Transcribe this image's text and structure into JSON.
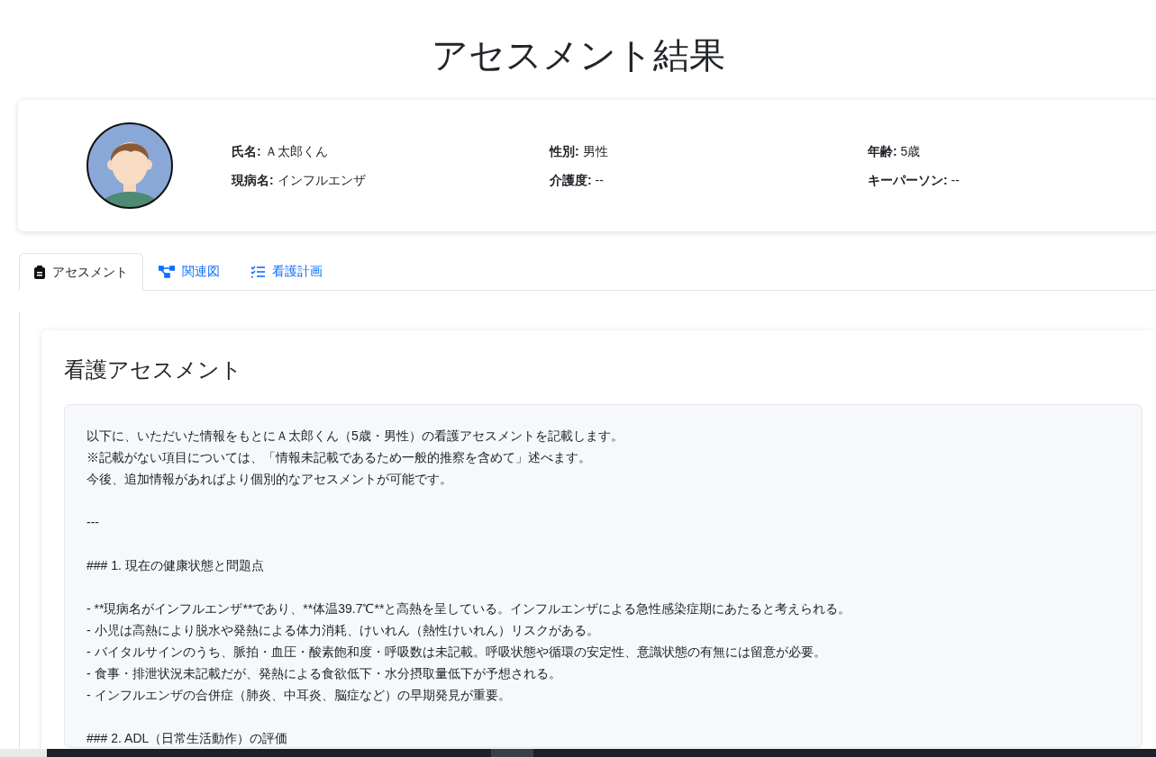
{
  "page_title": "アセスメント結果",
  "patient": {
    "fields": [
      {
        "label": "氏名:",
        "value": "Ａ太郎くん"
      },
      {
        "label": "性別:",
        "value": "男性"
      },
      {
        "label": "年齢:",
        "value": "5歳"
      },
      {
        "label": "現病名:",
        "value": "インフルエンザ"
      },
      {
        "label": "介護度:",
        "value": "--"
      },
      {
        "label": "キーパーソン:",
        "value": "--"
      }
    ]
  },
  "tabs": [
    {
      "label": "アセスメント",
      "kind": "clipboard",
      "selected": true
    },
    {
      "label": "関連図",
      "kind": "diagram",
      "selected": false
    },
    {
      "label": "看護計画",
      "kind": "checklist",
      "selected": false
    }
  ],
  "assessment": {
    "title": "看護アセスメント",
    "blocks": [
      [
        "以下に、いただいた情報をもとにＡ太郎くん（5歳・男性）の看護アセスメントを記載します。",
        "※記載がない項目については、「情報未記載であるため一般的推察を含めて」述べます。",
        "今後、追加情報があればより個別的なアセスメントが可能です。"
      ],
      [
        "---"
      ],
      [
        "### 1. 現在の健康状態と問題点"
      ],
      [
        "- **現病名がインフルエンザ**であり、**体温39.7℃**と高熱を呈している。インフルエンザによる急性感染症期にあたると考えられる。",
        "- 小児は高熱により脱水や発熱による体力消耗、けいれん（熱性けいれん）リスクがある。",
        "- バイタルサインのうち、脈拍・血圧・酸素飽和度・呼吸数は未記載。呼吸状態や循環の安定性、意識状態の有無には留意が必要。",
        "- 食事・排泄状況未記載だが、発熱による食欲低下・水分摂取量低下が予想される。",
        "- インフルエンザの合併症（肺炎、中耳炎、脳症など）の早期発見が重要。"
      ],
      [
        "### 2. ADL（日常生活動作）の評価"
      ]
    ]
  }
}
